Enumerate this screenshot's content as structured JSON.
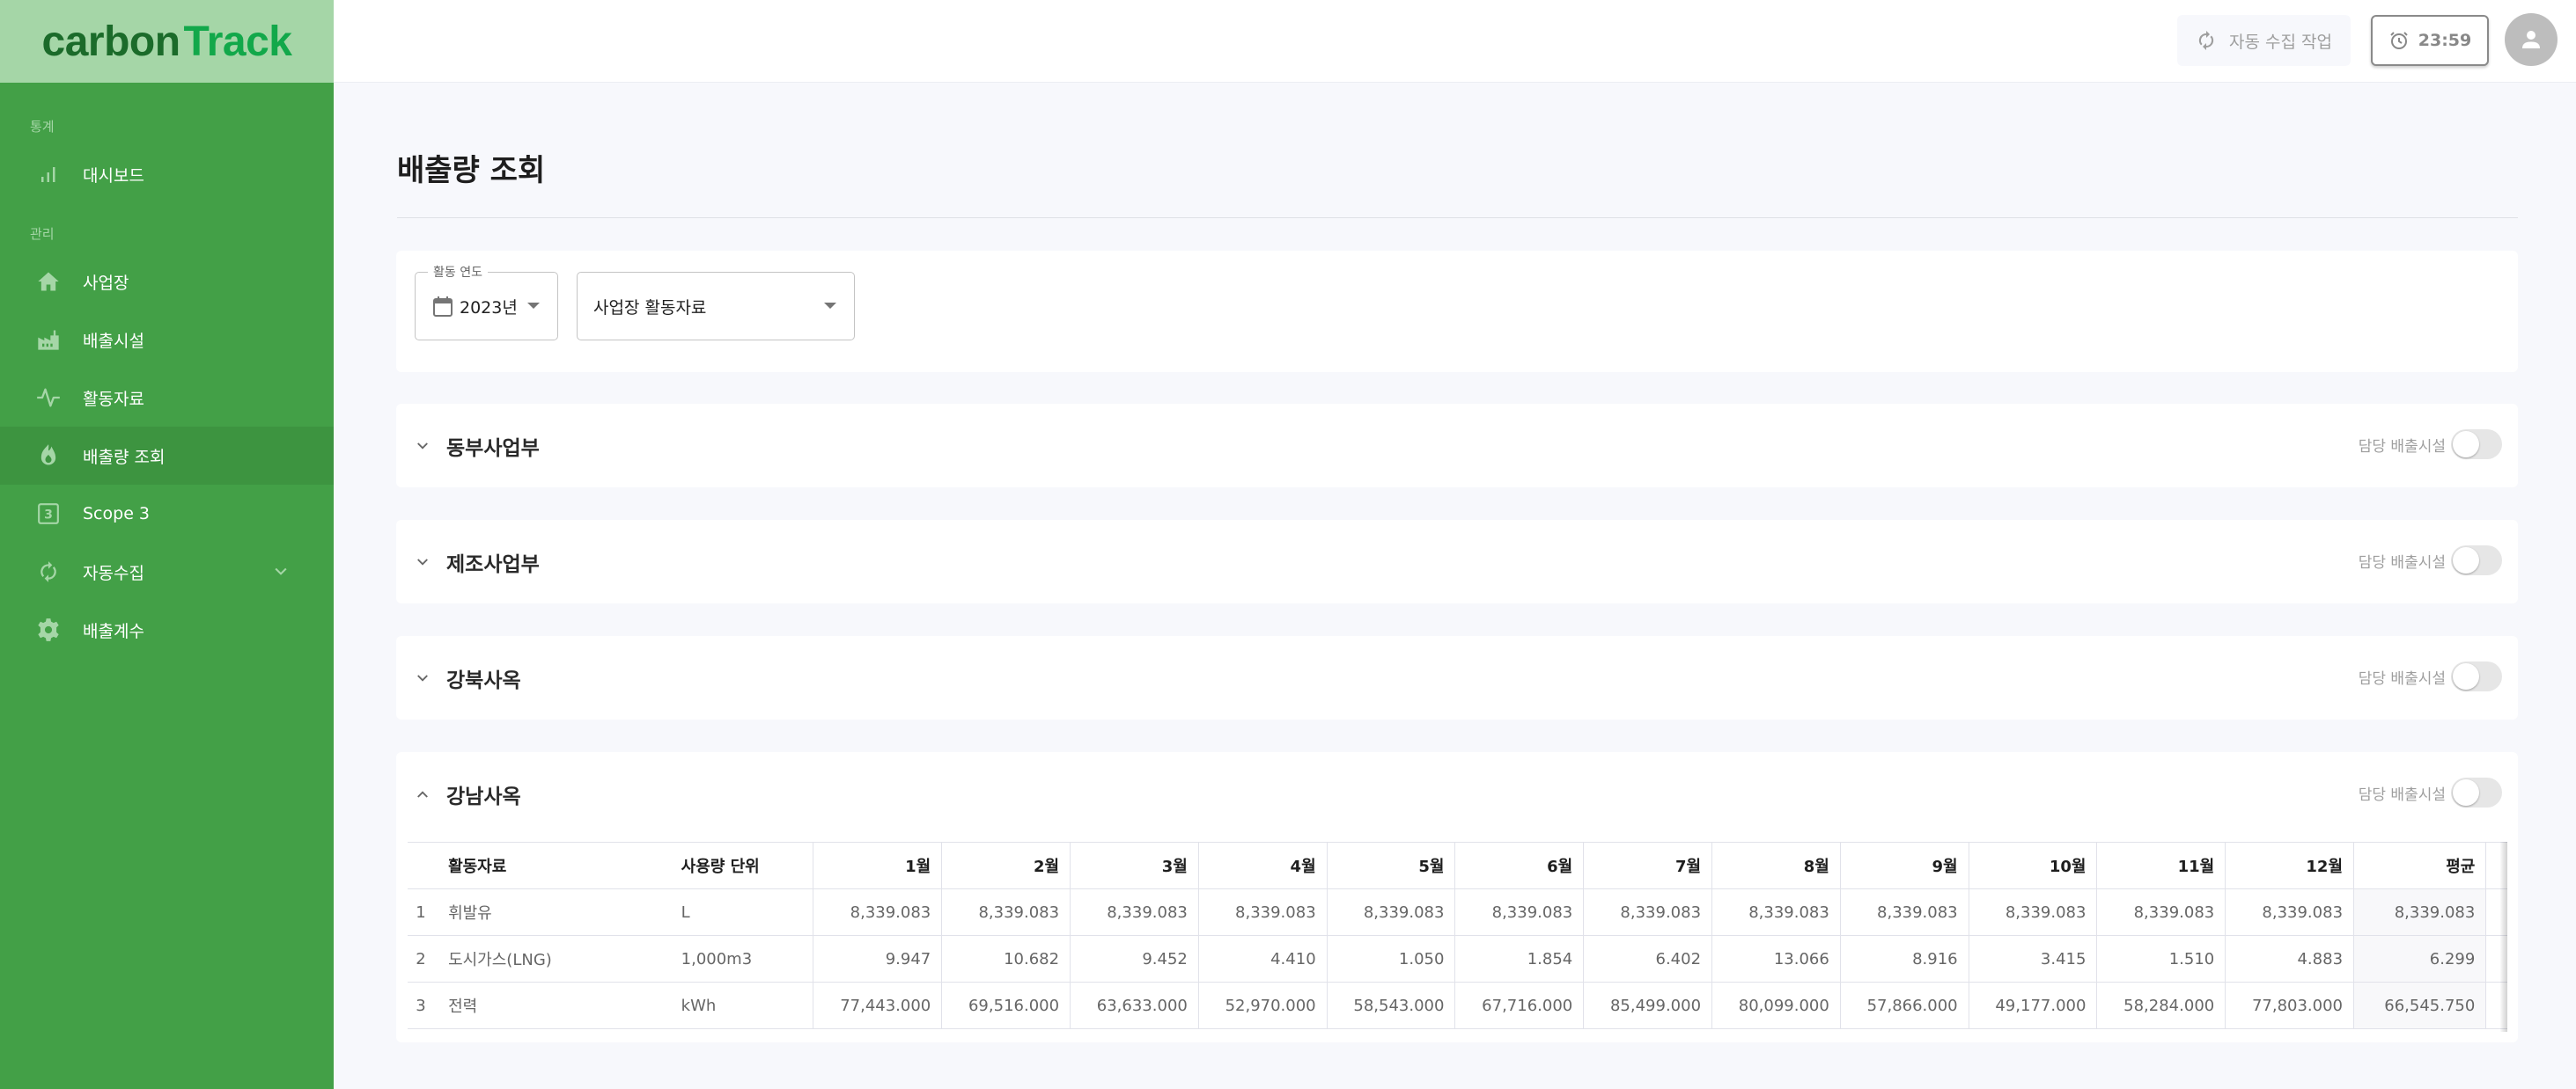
{
  "app": {
    "logo_part1": "carbon",
    "logo_part2": "Track",
    "colors": {
      "sidebar": "#43a047",
      "sidebar_active": "#3d9440",
      "logo_bg": "#a5d6a7",
      "logo_dark": "#1b6b2a",
      "logo_accent": "#12a84a"
    }
  },
  "sidebar": {
    "sections": [
      {
        "label": "통계",
        "items": [
          {
            "label": "대시보드",
            "icon": "bar-chart-icon",
            "active": false
          }
        ]
      },
      {
        "label": "관리",
        "items": [
          {
            "label": "사업장",
            "icon": "home-icon",
            "active": false
          },
          {
            "label": "배출시설",
            "icon": "factory-icon",
            "active": false
          },
          {
            "label": "활동자료",
            "icon": "activity-pulse-icon",
            "active": false
          },
          {
            "label": "배출량 조회",
            "icon": "flame-icon",
            "active": true
          },
          {
            "label": "Scope 3",
            "icon": "scope-3-box-icon",
            "active": false
          },
          {
            "label": "자동수집",
            "icon": "sync-icon",
            "active": false,
            "expandable": true
          },
          {
            "label": "배출계수",
            "icon": "gear-icon",
            "active": false
          }
        ]
      }
    ]
  },
  "header": {
    "auto_collect_label": "자동 수집 작업",
    "clock_time": "23:59"
  },
  "page": {
    "title": "배출량 조회"
  },
  "filters": {
    "year_legend": "활동 연도",
    "year_value": "2023년",
    "type_value": "사업장 활동자료"
  },
  "sites": [
    {
      "name": "동부사업부",
      "expanded": false,
      "toggle_label": "담당 배출시설",
      "toggle_on": false
    },
    {
      "name": "제조사업부",
      "expanded": false,
      "toggle_label": "담당 배출시설",
      "toggle_on": false
    },
    {
      "name": "강북사옥",
      "expanded": false,
      "toggle_label": "담당 배출시설",
      "toggle_on": false
    },
    {
      "name": "강남사옥",
      "expanded": true,
      "toggle_label": "담당 배출시설",
      "toggle_on": false
    }
  ],
  "table": {
    "columns": [
      "",
      "활동자료",
      "사용량 단위",
      "1월",
      "2월",
      "3월",
      "4월",
      "5월",
      "6월",
      "7월",
      "8월",
      "9월",
      "10월",
      "11월",
      "12월",
      "평균",
      ""
    ],
    "rows": [
      {
        "idx": "1",
        "name": "휘발유",
        "unit": "L",
        "months": [
          "8,339.083",
          "8,339.083",
          "8,339.083",
          "8,339.083",
          "8,339.083",
          "8,339.083",
          "8,339.083",
          "8,339.083",
          "8,339.083",
          "8,339.083",
          "8,339.083",
          "8,339.083"
        ],
        "avg": "8,339.083"
      },
      {
        "idx": "2",
        "name": "도시가스(LNG)",
        "unit": "1,000m3",
        "months": [
          "9.947",
          "10.682",
          "9.452",
          "4.410",
          "1.050",
          "1.854",
          "6.402",
          "13.066",
          "8.916",
          "3.415",
          "1.510",
          "4.883"
        ],
        "avg": "6.299"
      },
      {
        "idx": "3",
        "name": "전력",
        "unit": "kWh",
        "months": [
          "77,443.000",
          "69,516.000",
          "63,633.000",
          "52,970.000",
          "58,543.000",
          "67,716.000",
          "85,499.000",
          "80,099.000",
          "57,866.000",
          "49,177.000",
          "58,284.000",
          "77,803.000"
        ],
        "avg": "66,545.750"
      }
    ]
  }
}
